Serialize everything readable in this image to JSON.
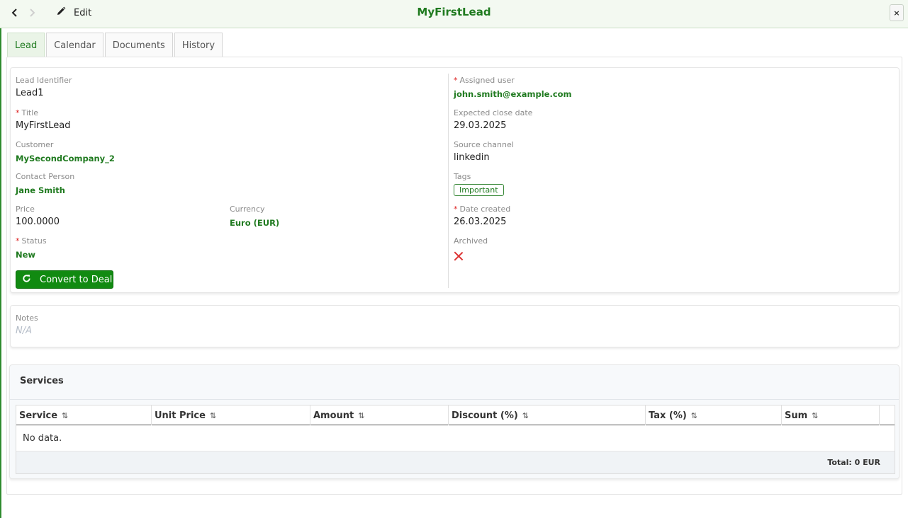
{
  "header": {
    "title": "MyFirstLead",
    "edit_label": "Edit",
    "close_label": "×"
  },
  "tabs": [
    {
      "label": "Lead",
      "active": true
    },
    {
      "label": "Calendar",
      "active": false
    },
    {
      "label": "Documents",
      "active": false
    },
    {
      "label": "History",
      "active": false
    }
  ],
  "lead": {
    "identifier": {
      "label": "Lead Identifier",
      "value": "Lead1"
    },
    "title": {
      "label": "Title",
      "value": "MyFirstLead",
      "required": true
    },
    "customer": {
      "label": "Customer",
      "value": "MySecondCompany_2"
    },
    "contact_person": {
      "label": "Contact Person",
      "value": "Jane Smith"
    },
    "price": {
      "label": "Price",
      "value": "100.0000"
    },
    "currency": {
      "label": "Currency",
      "value": "Euro (EUR)"
    },
    "status": {
      "label": "Status",
      "value": "New",
      "required": true
    },
    "convert_button": "Convert to Deal",
    "assigned_user": {
      "label": "Assigned user",
      "value": "john.smith@example.com",
      "required": true
    },
    "expected_close_date": {
      "label": "Expected close date",
      "value": "29.03.2025"
    },
    "source_channel": {
      "label": "Source channel",
      "value": "linkedin"
    },
    "tags": {
      "label": "Tags",
      "items": [
        "Important"
      ]
    },
    "date_created": {
      "label": "Date created",
      "value": "26.03.2025",
      "required": true
    },
    "archived": {
      "label": "Archived",
      "value": false
    }
  },
  "notes": {
    "label": "Notes",
    "value": "N/A"
  },
  "services": {
    "title": "Services",
    "columns": [
      "Service",
      "Unit Price",
      "Amount",
      "Discount (%)",
      "Tax (%)",
      "Sum"
    ],
    "sort_icon": "⇅",
    "empty_text": "No data.",
    "total": "Total: 0 EUR"
  },
  "colors": {
    "accent": "#1f7a1f",
    "button": "#118a11",
    "required": "#dd2222",
    "archived_x": "#dd3333"
  }
}
